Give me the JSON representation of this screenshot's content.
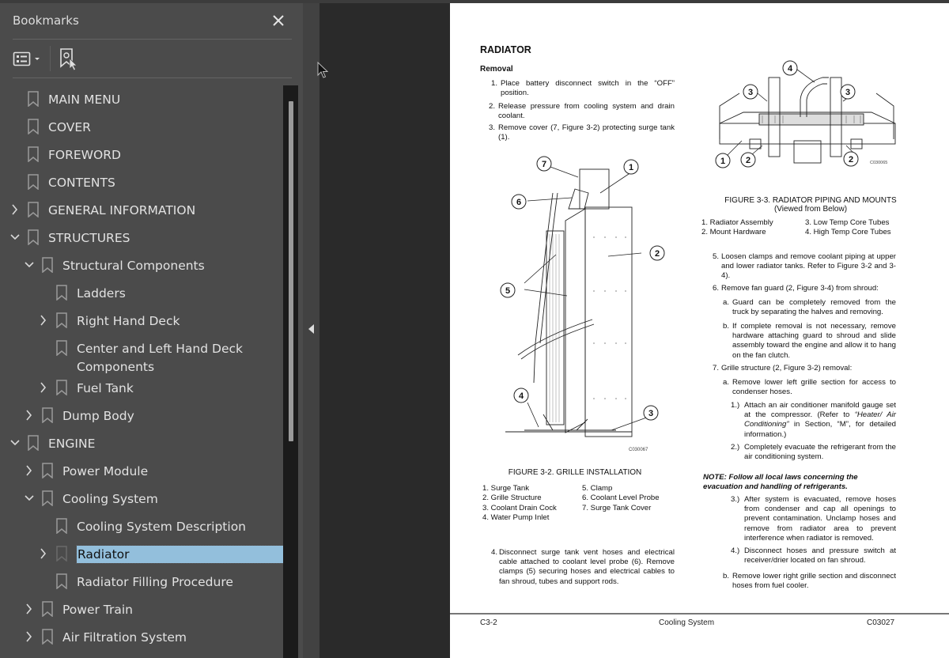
{
  "bookmarks_panel": {
    "title": "Bookmarks",
    "close_icon": "close-icon",
    "toolbar": {
      "options_icon": "list-options-icon",
      "find_icon": "find-current-bookmark-icon"
    },
    "items": [
      {
        "label": "MAIN MENU",
        "level": 0,
        "expander": "none"
      },
      {
        "label": "COVER",
        "level": 0,
        "expander": "none"
      },
      {
        "label": "FOREWORD",
        "level": 0,
        "expander": "none"
      },
      {
        "label": "CONTENTS",
        "level": 0,
        "expander": "none"
      },
      {
        "label": "GENERAL INFORMATION",
        "level": 0,
        "expander": "collapsed"
      },
      {
        "label": "STRUCTURES",
        "level": 0,
        "expander": "expanded"
      },
      {
        "label": "Structural Components",
        "level": 1,
        "expander": "expanded"
      },
      {
        "label": "Ladders",
        "level": 2,
        "expander": "none"
      },
      {
        "label": "Right Hand Deck",
        "level": 2,
        "expander": "collapsed"
      },
      {
        "label": "Center and Left Hand Deck",
        "label_line2": "Components",
        "level": 2,
        "expander": "none"
      },
      {
        "label": "Fuel Tank",
        "level": 2,
        "expander": "collapsed"
      },
      {
        "label": "Dump Body",
        "level": 1,
        "expander": "collapsed"
      },
      {
        "label": "ENGINE",
        "level": 0,
        "expander": "expanded"
      },
      {
        "label": "Power Module",
        "level": 1,
        "expander": "collapsed"
      },
      {
        "label": "Cooling System",
        "level": 1,
        "expander": "expanded"
      },
      {
        "label": "Cooling System Description",
        "level": 2,
        "expander": "none"
      },
      {
        "label": "Radiator",
        "level": 2,
        "expander": "collapsed",
        "selected": true
      },
      {
        "label": "Radiator Filling Procedure",
        "level": 2,
        "expander": "none"
      },
      {
        "label": "Power Train",
        "level": 1,
        "expander": "collapsed"
      },
      {
        "label": "Air Filtration System",
        "level": 1,
        "expander": "collapsed"
      }
    ],
    "selection_color": "#93bfdc"
  },
  "document": {
    "heading": "RADIATOR",
    "subheading": "Removal",
    "steps_left": [
      {
        "n": "1.",
        "text": "Place battery disconnect switch in the “OFF” position."
      },
      {
        "n": "2.",
        "text": "Release pressure from cooling system and drain coolant."
      },
      {
        "n": "3.",
        "text": "Remove cover (7, Figure 3-2) protecting surge tank (1)."
      }
    ],
    "figure_3_2": {
      "callouts": [
        "1",
        "2",
        "3",
        "4",
        "5",
        "6",
        "7"
      ],
      "code": "C030067",
      "caption": "FIGURE 3-2. GRILLE INSTALLATION",
      "legend_col1": [
        "1. Surge Tank",
        "2. Grille Structure",
        "3. Coolant Drain Cock",
        "4. Water Pump Inlet"
      ],
      "legend_col2": [
        "5. Clamp",
        "6. Coolant Level Probe",
        "7. Surge Tank Cover"
      ]
    },
    "step_4": {
      "n": "4.",
      "text": "Disconnect surge tank vent hoses and electrical cable attached to coolant level probe (6). Remove clamps (5) securing hoses and electrical cables to fan shroud, tubes and support rods."
    },
    "figure_3_3": {
      "callouts": [
        "1",
        "2",
        "2",
        "3",
        "3",
        "4"
      ],
      "code": "C030065",
      "caption_line1": "FIGURE 3-3. RADIATOR PIPING AND MOUNTS",
      "caption_line2": "(Viewed from Below)",
      "legend_col1": [
        "1. Radiator Assembly",
        "2. Mount Hardware"
      ],
      "legend_col2": [
        "3. Low Temp Core Tubes",
        "4. High Temp Core Tubes"
      ]
    },
    "steps_right": {
      "step5": {
        "n": "5.",
        "text": "Loosen clamps and remove coolant piping at upper and lower radiator tanks. Refer to Figure 3-2 and 3-4)."
      },
      "step6": {
        "n": "6.",
        "text": "Remove fan guard (2, Figure 3-4) from shroud:"
      },
      "step6a": {
        "n": "a.",
        "text": "Guard can be completely removed from the truck by separating the halves and removing."
      },
      "step6b": {
        "n": "b.",
        "text": "If complete removal is not necessary, remove hardware attaching guard to shroud and slide assembly toward the engine and allow it to hang on the fan clutch."
      },
      "step7": {
        "n": "7.",
        "text": "Grille structure (2, Figure 3-2) removal:"
      },
      "step7a": {
        "n": "a.",
        "text": "Remove lower left grille section for access to condenser hoses."
      },
      "step7a1": {
        "n": "1.)",
        "text_pre": "Attach an air conditioner manifold gauge set at the compressor. (Refer to ",
        "text_em": "“Heater/ Air Conditioning”",
        "text_post": " in Section, “M”, for detailed information.)"
      },
      "step7a2": {
        "n": "2.)",
        "text": "Completely evacuate the refrigerant from the air conditioning system."
      },
      "note": "NOTE: Follow all local laws concerning the evacuation and handling of refrigerants.",
      "step7a3": {
        "n": "3.)",
        "text": "After system is evacuated, remove hoses from condenser and cap all openings to prevent contamination. Unclamp hoses and remove from radiator area to prevent interference when radiator is removed."
      },
      "step7a4": {
        "n": "4.)",
        "text": "Disconnect hoses and pressure switch at receiver/drier located on fan shroud."
      },
      "step7b": {
        "n": "b.",
        "text": "Remove lower right grille section and disconnect hoses from fuel cooler."
      }
    },
    "footer": {
      "left": "C3-2",
      "center": "Cooling System",
      "right": "C03027"
    }
  }
}
